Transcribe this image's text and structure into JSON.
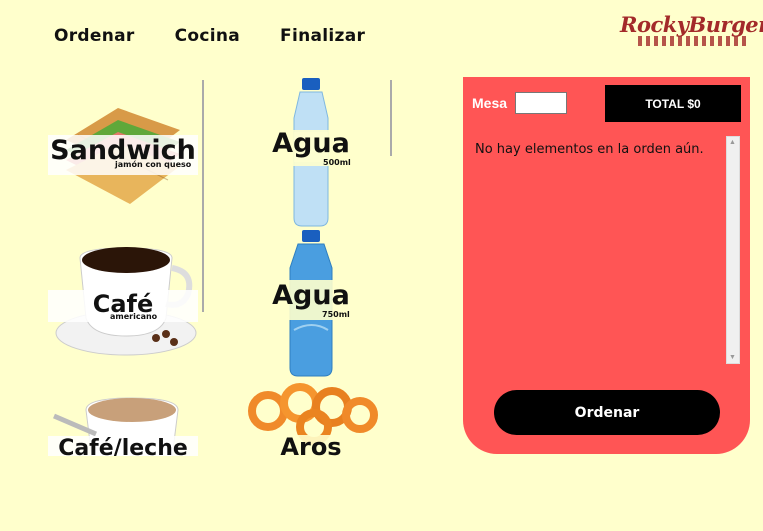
{
  "nav": {
    "items": [
      "Ordenar",
      "Cocina",
      "Finalizar"
    ]
  },
  "logo": {
    "text": "RockyBurger"
  },
  "menu": {
    "items": [
      {
        "title": "Sandwich",
        "subtitle": "jamón con queso"
      },
      {
        "title": "Agua",
        "subtitle": "500ml"
      },
      {
        "title": "Café",
        "subtitle": "americano"
      },
      {
        "title": "Agua",
        "subtitle": "750ml"
      },
      {
        "title": "Café/leche",
        "subtitle": ""
      },
      {
        "title": "Aros",
        "subtitle": ""
      }
    ]
  },
  "order": {
    "mesa_label": "Mesa",
    "mesa_value": "",
    "total_label": "TOTAL $0",
    "empty_message": "No hay elementos en la orden aún.",
    "submit_label": "Ordenar"
  },
  "colors": {
    "background": "#ffffcc",
    "panel": "#ff5555",
    "button": "#000000",
    "brand": "#a32a2a"
  }
}
